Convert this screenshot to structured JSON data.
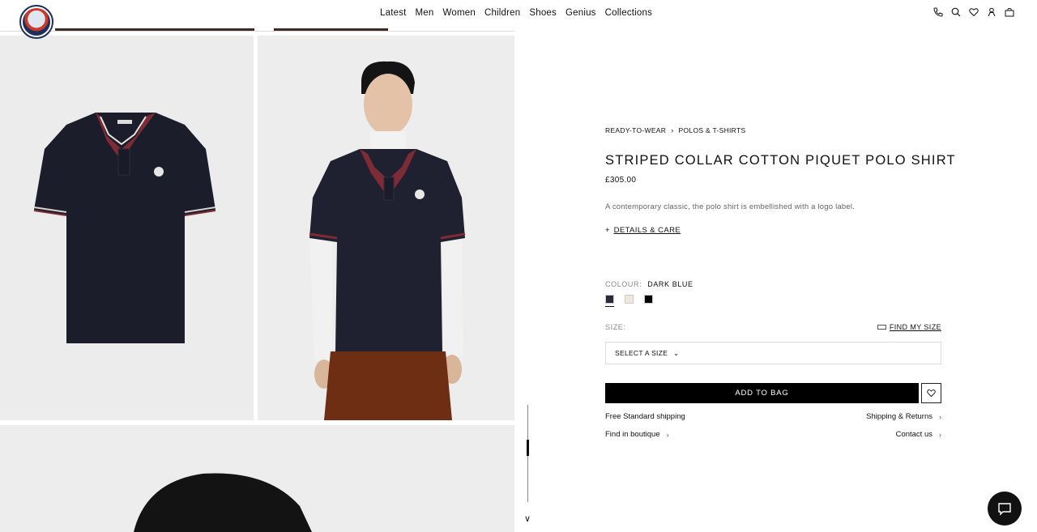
{
  "header": {
    "brand": "MONCLER",
    "nav": [
      "Latest",
      "Men",
      "Women",
      "Children",
      "Shoes",
      "Genius",
      "Collections"
    ],
    "icons": [
      "phone-icon",
      "search-icon",
      "heart-icon",
      "account-icon",
      "bag-icon"
    ]
  },
  "gallery": {
    "images": [
      "polo-flat-image",
      "model-front-image",
      "model-closeup-image"
    ]
  },
  "product": {
    "breadcrumb": [
      "READY-TO-WEAR",
      "POLOS & T-SHIRTS"
    ],
    "title": "STRIPED COLLAR COTTON PIQUET POLO SHIRT",
    "price": "£305.00",
    "description": "A contemporary classic, the polo shirt is embellished with a logo label.",
    "details_label": "DETAILS & CARE",
    "colour_label": "COLOUR:",
    "colour_value": "DARK BLUE",
    "swatches": [
      "#2b2b3a",
      "#efe6dc",
      "#000000"
    ],
    "size_label": "SIZE:",
    "find_size_label": "FIND MY SIZE",
    "size_select": "SELECT A SIZE",
    "add_to_bag": "ADD TO BAG",
    "services": {
      "free_shipping": "Free Standard shipping",
      "shipping_returns": "Shipping & Returns",
      "find_boutique": "Find in boutique",
      "contact": "Contact us"
    }
  },
  "colors": {
    "brand_navy": "#1d2f5a",
    "black": "#000000"
  }
}
